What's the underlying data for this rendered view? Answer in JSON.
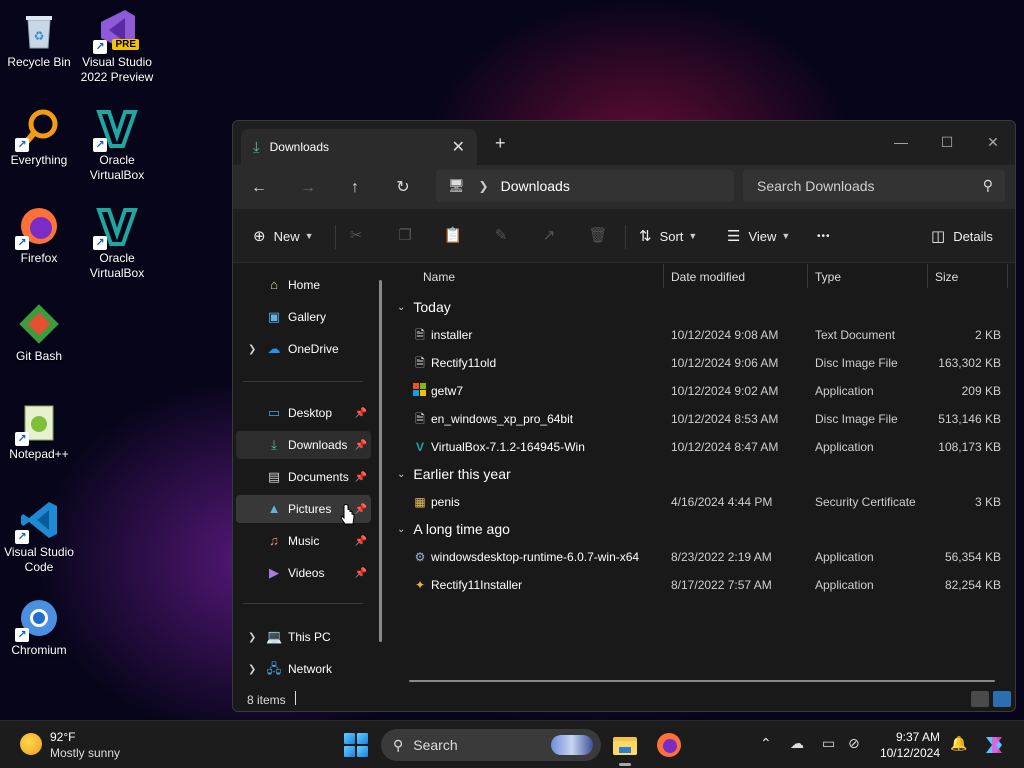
{
  "desktop": {
    "icons": [
      {
        "label": "Recycle Bin"
      },
      {
        "label": "Visual Studio 2022 Preview",
        "badge": "PRE"
      },
      {
        "label": "Everything"
      },
      {
        "label": "Oracle VirtualBox"
      },
      {
        "label": "Firefox"
      },
      {
        "label": "Oracle VirtualBox"
      },
      {
        "label": "Git Bash"
      },
      {
        "label": "Notepad++"
      },
      {
        "label": "Visual Studio Code"
      },
      {
        "label": "Chromium"
      }
    ]
  },
  "window": {
    "tab_title": "Downloads",
    "address": {
      "crumb": "Downloads"
    },
    "search_placeholder": "Search Downloads",
    "toolbar": {
      "new_label": "New",
      "sort_label": "Sort",
      "view_label": "View",
      "more_label": "•••",
      "details_label": "Details"
    },
    "sidebar": {
      "items": [
        {
          "label": "Home",
          "icon": "home-icon"
        },
        {
          "label": "Gallery",
          "icon": "gallery-icon"
        },
        {
          "label": "OneDrive",
          "icon": "onedrive-icon"
        },
        {
          "label": "Desktop",
          "icon": "desktop-folder-icon"
        },
        {
          "label": "Downloads",
          "icon": "downloads-folder-icon"
        },
        {
          "label": "Documents",
          "icon": "documents-folder-icon"
        },
        {
          "label": "Pictures",
          "icon": "pictures-folder-icon"
        },
        {
          "label": "Music",
          "icon": "music-folder-icon"
        },
        {
          "label": "Videos",
          "icon": "videos-folder-icon"
        },
        {
          "label": "This PC",
          "icon": "this-pc-icon"
        },
        {
          "label": "Network",
          "icon": "network-icon"
        }
      ]
    },
    "columns": {
      "name": "Name",
      "date": "Date modified",
      "type": "Type",
      "size": "Size"
    },
    "groups": [
      {
        "label": "Today",
        "files": [
          {
            "name": "installer",
            "date": "10/12/2024 9:08 AM",
            "type": "Text Document",
            "size": "2 KB"
          },
          {
            "name": "Rectify11old",
            "date": "10/12/2024 9:06 AM",
            "type": "Disc Image File",
            "size": "163,302 KB"
          },
          {
            "name": "getw7",
            "date": "10/12/2024 9:02 AM",
            "type": "Application",
            "size": "209 KB"
          },
          {
            "name": "en_windows_xp_pro_64bit",
            "date": "10/12/2024 8:53 AM",
            "type": "Disc Image File",
            "size": "513,146 KB"
          },
          {
            "name": "VirtualBox-7.1.2-164945-Win",
            "date": "10/12/2024 8:47 AM",
            "type": "Application",
            "size": "108,173 KB"
          }
        ]
      },
      {
        "label": "Earlier this year",
        "files": [
          {
            "name": "penis",
            "date": "4/16/2024 4:44 PM",
            "type": "Security Certificate",
            "size": "3 KB"
          }
        ]
      },
      {
        "label": "A long time ago",
        "files": [
          {
            "name": "windowsdesktop-runtime-6.0.7-win-x64",
            "date": "8/23/2022 2:19 AM",
            "type": "Application",
            "size": "56,354 KB"
          },
          {
            "name": "Rectify11Installer",
            "date": "8/17/2022 7:57 AM",
            "type": "Application",
            "size": "82,254 KB"
          }
        ]
      }
    ],
    "status": {
      "count": "8 items"
    }
  },
  "taskbar": {
    "weather": {
      "temp": "92°F",
      "condition": "Mostly sunny"
    },
    "search_label": "Search",
    "clock": {
      "time": "9:37 AM",
      "date": "10/12/2024"
    }
  }
}
